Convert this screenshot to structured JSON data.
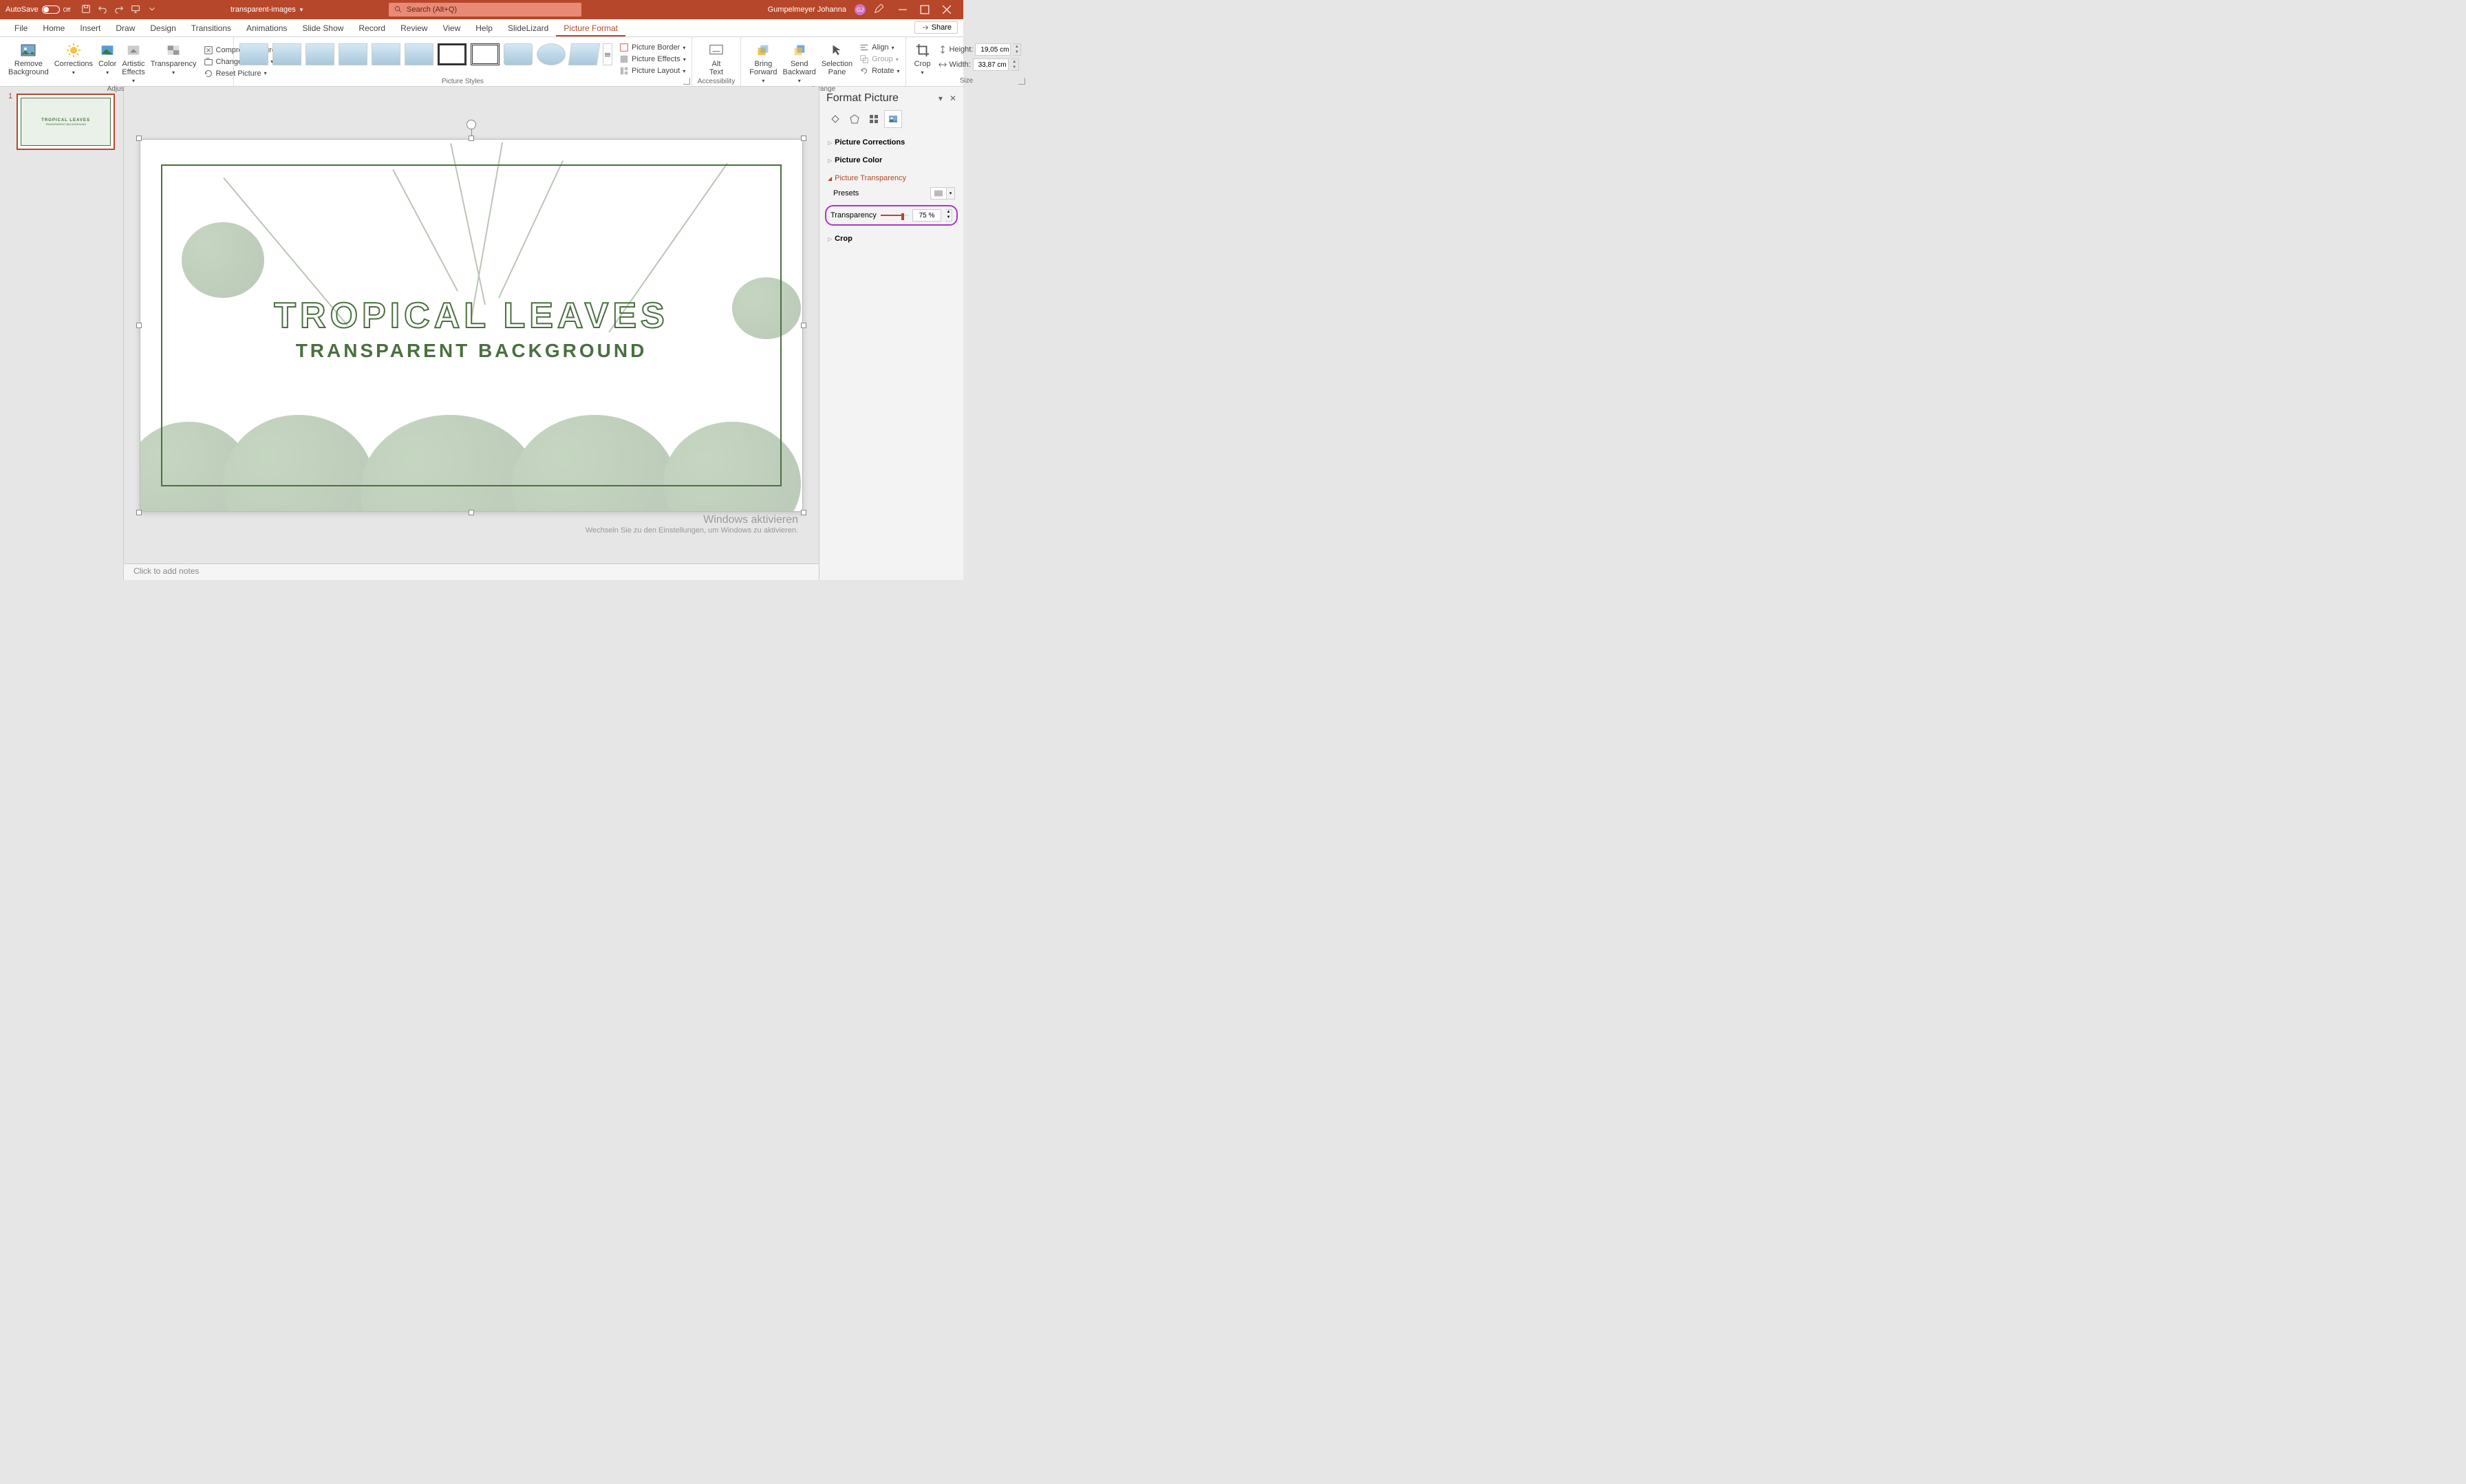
{
  "titlebar": {
    "autosave_label": "AutoSave",
    "autosave_state": "Off",
    "document_name": "transparent-images",
    "search_placeholder": "Search (Alt+Q)",
    "user_name": "Gumpelmeyer Johanna",
    "user_initials": "GJ"
  },
  "tabs": {
    "items": [
      "File",
      "Home",
      "Insert",
      "Draw",
      "Design",
      "Transitions",
      "Animations",
      "Slide Show",
      "Record",
      "Review",
      "View",
      "Help",
      "SlideLizard",
      "Picture Format"
    ],
    "active_index": 13,
    "share_label": "Share"
  },
  "ribbon": {
    "adjust": {
      "remove_bg": "Remove\nBackground",
      "corrections": "Corrections",
      "color": "Color",
      "artistic": "Artistic\nEffects",
      "transparency": "Transparency",
      "compress": "Compress Pictures",
      "change": "Change Picture",
      "reset": "Reset Picture",
      "label": "Adjust"
    },
    "styles": {
      "border": "Picture Border",
      "effects": "Picture Effects",
      "layout": "Picture Layout",
      "label": "Picture Styles"
    },
    "access": {
      "alt_text": "Alt\nText",
      "label": "Accessibility"
    },
    "arrange": {
      "forward": "Bring\nForward",
      "backward": "Send\nBackward",
      "selection": "Selection\nPane",
      "align": "Align",
      "group": "Group",
      "rotate": "Rotate",
      "label": "Arrange"
    },
    "size": {
      "crop": "Crop",
      "height_label": "Height:",
      "height_value": "19,05 cm",
      "width_label": "Width:",
      "width_value": "33,87 cm",
      "label": "Size"
    }
  },
  "thumbs": {
    "slide1_number": "1"
  },
  "slide": {
    "title": "TROPICAL LEAVES",
    "subtitle": "TRANSPARENT BACKGROUND"
  },
  "watermark": {
    "line1": "Windows aktivieren",
    "line2": "Wechseln Sie zu den Einstellungen, um Windows zu aktivieren."
  },
  "notes": {
    "placeholder": "Click to add notes"
  },
  "pane": {
    "title": "Format Picture",
    "sec_corrections": "Picture Corrections",
    "sec_color": "Picture Color",
    "sec_transparency": "Picture Transparency",
    "presets_label": "Presets",
    "transparency_label": "Transparency",
    "transparency_value": "75 %",
    "sec_crop": "Crop"
  }
}
